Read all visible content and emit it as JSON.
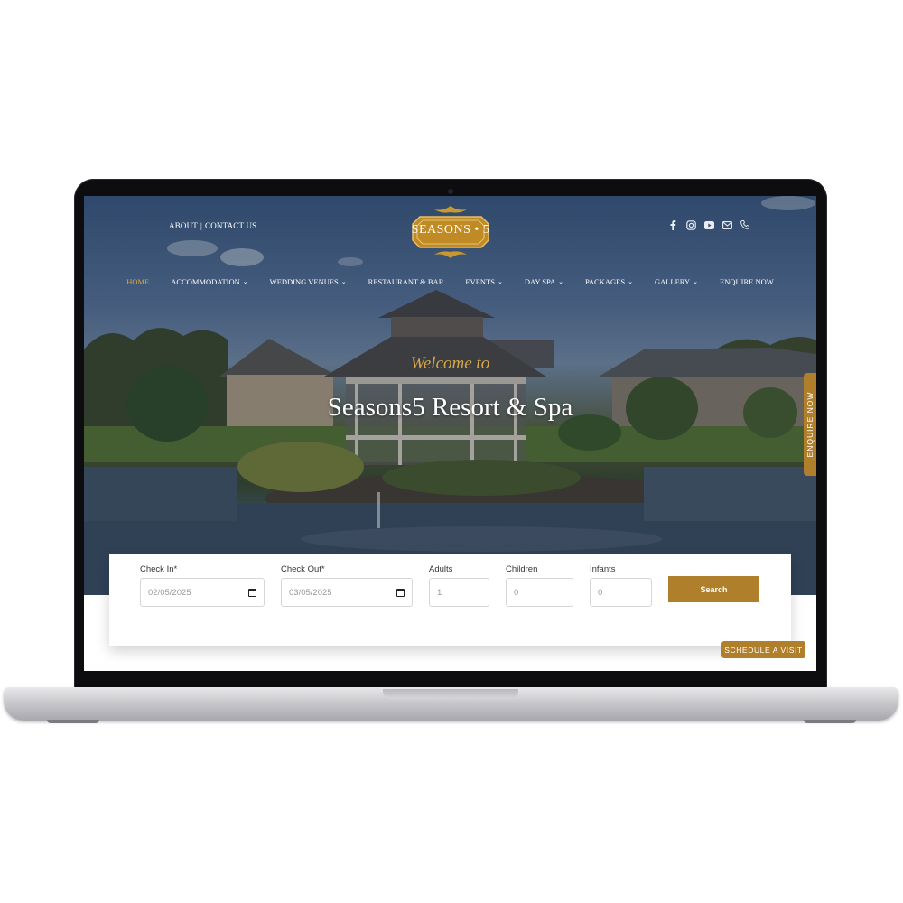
{
  "header": {
    "top_links": {
      "about": "ABOUT",
      "separator": "|",
      "contact": "CONTACT US"
    },
    "logo_text": "SEASONS • 5",
    "social_icons": [
      "facebook-icon",
      "instagram-icon",
      "youtube-icon",
      "email-icon",
      "phone-icon"
    ]
  },
  "nav": {
    "items": [
      {
        "label": "HOME",
        "active": true,
        "dropdown": false
      },
      {
        "label": "ACCOMMODATION",
        "dropdown": true
      },
      {
        "label": "WEDDING VENUES",
        "dropdown": true
      },
      {
        "label": "RESTAURANT & BAR",
        "dropdown": false
      },
      {
        "label": "EVENTS",
        "dropdown": true
      },
      {
        "label": "DAY SPA",
        "dropdown": true
      },
      {
        "label": "PACKAGES",
        "dropdown": true
      },
      {
        "label": "GALLERY",
        "dropdown": true
      },
      {
        "label": "ENQUIRE NOW",
        "dropdown": false
      }
    ],
    "chevron": "⌄"
  },
  "hero": {
    "welcome": "Welcome to",
    "title": "Seasons5 Resort & Spa"
  },
  "side_tab": {
    "label": "ENQUIRE NOW"
  },
  "booking": {
    "check_in": {
      "label": "Check In*",
      "value": "02/05/2025"
    },
    "check_out": {
      "label": "Check Out*",
      "value": "03/05/2025"
    },
    "adults": {
      "label": "Adults",
      "value": "1"
    },
    "children": {
      "label": "Children",
      "value": "0"
    },
    "infants": {
      "label": "Infants",
      "value": "0"
    },
    "search_label": "Search"
  },
  "schedule_visit": {
    "label": "SCHEDULE A VISIT"
  },
  "colors": {
    "accent": "#b07f2c",
    "nav_active": "#d9a93c",
    "welcome": "#d6a747"
  }
}
